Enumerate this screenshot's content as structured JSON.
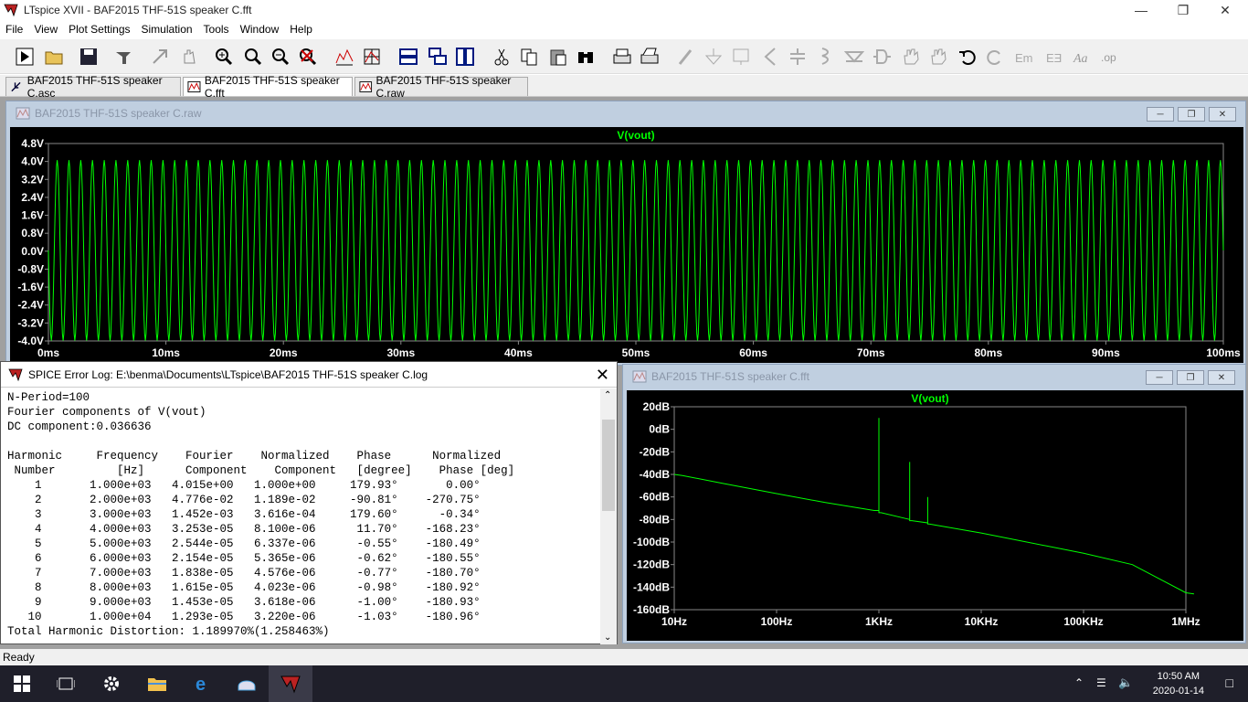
{
  "app": {
    "title": "LTspice XVII - BAF2015 THF-51S speaker C.fft",
    "icon": "ltspice-icon",
    "window_controls": [
      "minimize-icon",
      "restore-icon",
      "close-icon"
    ]
  },
  "menu": [
    "File",
    "View",
    "Plot Settings",
    "Simulation",
    "Tools",
    "Window",
    "Help"
  ],
  "toolbar": {
    "icons": [
      "run-icon",
      "open-icon",
      "save-icon",
      "control-panel-icon",
      "cross-probe-icon",
      "pan-icon",
      "zoom-in-icon",
      "zoom-fit-icon",
      "zoom-out-icon",
      "zoom-cancel-icon",
      "autorange-icon",
      "grid-icon",
      "tile-horizontal-icon",
      "cascade-icon",
      "tile-vertical-icon",
      "cut-icon",
      "copy-icon",
      "paste-icon",
      "find-icon",
      "print-icon",
      "print-setup-icon",
      "wire-icon",
      "ground-icon",
      "label-icon",
      "resistor-icon",
      "capacitor-icon",
      "inductor-icon",
      "diode-icon",
      "component-icon",
      "move-icon",
      "drag-icon",
      "undo-icon",
      "redo-icon",
      "rotate-icon",
      "mirror-icon",
      "text-icon",
      "spice-directive-icon"
    ]
  },
  "tabs": [
    {
      "label": "BAF2015 THF-51S speaker C.asc",
      "icon": "schematic-icon"
    },
    {
      "label": "BAF2015 THF-51S speaker C.fft",
      "icon": "waveform-icon"
    },
    {
      "label": "BAF2015 THF-51S speaker C.raw",
      "icon": "waveform-icon"
    }
  ],
  "raw_window": {
    "title": "BAF2015 THF-51S speaker C.raw",
    "trace": "V(vout)",
    "trace_color": "#00ff00",
    "y_ticks": [
      "4.8V",
      "4.0V",
      "3.2V",
      "2.4V",
      "1.6V",
      "0.8V",
      "0.0V",
      "-0.8V",
      "-1.6V",
      "-2.4V",
      "-3.2V",
      "-4.0V"
    ],
    "x_ticks": [
      "0ms",
      "10ms",
      "20ms",
      "30ms",
      "40ms",
      "50ms",
      "60ms",
      "70ms",
      "80ms",
      "90ms",
      "100ms"
    ]
  },
  "fft_window": {
    "title": "BAF2015 THF-51S speaker C.fft",
    "trace": "V(vout)",
    "y_ticks": [
      "20dB",
      "0dB",
      "-20dB",
      "-40dB",
      "-60dB",
      "-80dB",
      "-100dB",
      "-120dB",
      "-140dB",
      "-160dB"
    ],
    "x_ticks": [
      "10Hz",
      "100Hz",
      "1KHz",
      "10KHz",
      "100KHz",
      "1MHz"
    ]
  },
  "log_window": {
    "title": "SPICE Error Log: E:\\benma\\Documents\\LTspice\\BAF2015 THF-51S speaker C.log",
    "lines": [
      "N-Period=100",
      "Fourier components of V(vout)",
      "DC component:0.036636",
      "",
      "Harmonic     Frequency    Fourier    Normalized    Phase      Normalized",
      " Number         [Hz]      Component    Component   [degree]    Phase [deg]",
      "    1       1.000e+03   4.015e+00   1.000e+00     179.93°       0.00°",
      "    2       2.000e+03   4.776e-02   1.189e-02     -90.81°    -270.75°",
      "    3       3.000e+03   1.452e-03   3.616e-04     179.60°      -0.34°",
      "    4       4.000e+03   3.253e-05   8.100e-06      11.70°    -168.23°",
      "    5       5.000e+03   2.544e-05   6.337e-06      -0.55°    -180.49°",
      "    6       6.000e+03   2.154e-05   5.365e-06      -0.62°    -180.55°",
      "    7       7.000e+03   1.838e-05   4.576e-06      -0.77°    -180.70°",
      "    8       8.000e+03   1.615e-05   4.023e-06      -0.98°    -180.92°",
      "    9       9.000e+03   1.453e-05   3.618e-06      -1.00°    -180.93°",
      "   10       1.000e+04   1.293e-05   3.220e-06      -1.03°    -180.96°",
      "Total Harmonic Distortion: 1.189970%(1.258463%)"
    ]
  },
  "status": "Ready",
  "taskbar": {
    "icons": [
      "windows-start-icon",
      "task-view-icon",
      "settings-icon",
      "file-explorer-icon",
      "edge-icon",
      "app-icon",
      "ltspice-taskbar-icon"
    ],
    "time": "10:50 AM",
    "date": "2020-01-14"
  },
  "chart_data": [
    {
      "type": "line",
      "title": "V(vout)",
      "xlabel": "",
      "ylabel": "",
      "x_unit": "ms",
      "xlim": [
        0,
        100
      ],
      "ylim": [
        -4.0,
        4.8
      ],
      "series": [
        {
          "name": "V(vout)",
          "frequency_hz": 1000,
          "amplitude_v": 4.02,
          "offset_v": 0.037
        }
      ]
    },
    {
      "type": "line",
      "title": "V(vout)",
      "x_scale": "log",
      "xlim": [
        10,
        1000000
      ],
      "ylim": [
        -160,
        20
      ],
      "series": [
        {
          "name": "V(vout)",
          "x": [
            10,
            12,
            30,
            100,
            300,
            900,
            1000,
            1000,
            1000,
            1050,
            2000,
            2000,
            2000,
            2100,
            3000,
            3000,
            3000,
            3100,
            10000,
            100000,
            300000,
            1000000,
            1200000
          ],
          "y": [
            -40,
            -41,
            -48,
            -57,
            -65,
            -72,
            -72,
            10,
            -74,
            -74,
            -80,
            -29,
            -81,
            -81,
            -83,
            -60,
            -84,
            -84,
            -92,
            -110,
            -120,
            -145,
            -146
          ]
        }
      ]
    }
  ]
}
